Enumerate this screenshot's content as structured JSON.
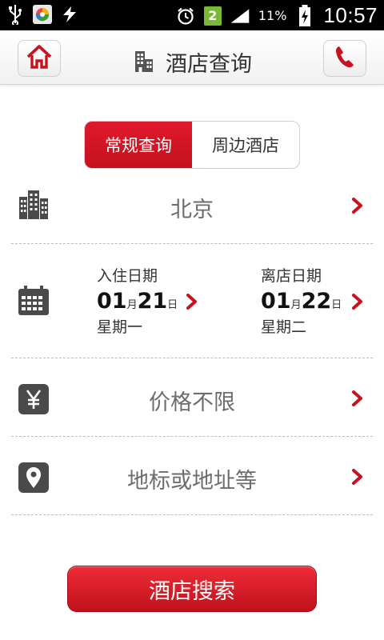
{
  "status_bar": {
    "badge": "2",
    "battery_pct": "11%",
    "time": "10:57"
  },
  "header": {
    "title": "酒店查询"
  },
  "tabs": [
    {
      "label": "常规查询",
      "active": true
    },
    {
      "label": "周边酒店",
      "active": false
    }
  ],
  "city": {
    "value": "北京"
  },
  "checkin": {
    "label": "入住日期",
    "month": "01",
    "month_unit": "月",
    "day": "21",
    "day_unit": "日",
    "weekday": "星期一"
  },
  "checkout": {
    "label": "离店日期",
    "month": "01",
    "month_unit": "月",
    "day": "22",
    "day_unit": "日",
    "weekday": "星期二"
  },
  "price": {
    "value": "价格不限",
    "icon_glyph": "¥"
  },
  "landmark": {
    "value": "地标或地址等"
  },
  "search_button": {
    "label": "酒店搜索"
  },
  "colors": {
    "accent": "#c8121f",
    "icon_gray": "#4a4a4a"
  }
}
